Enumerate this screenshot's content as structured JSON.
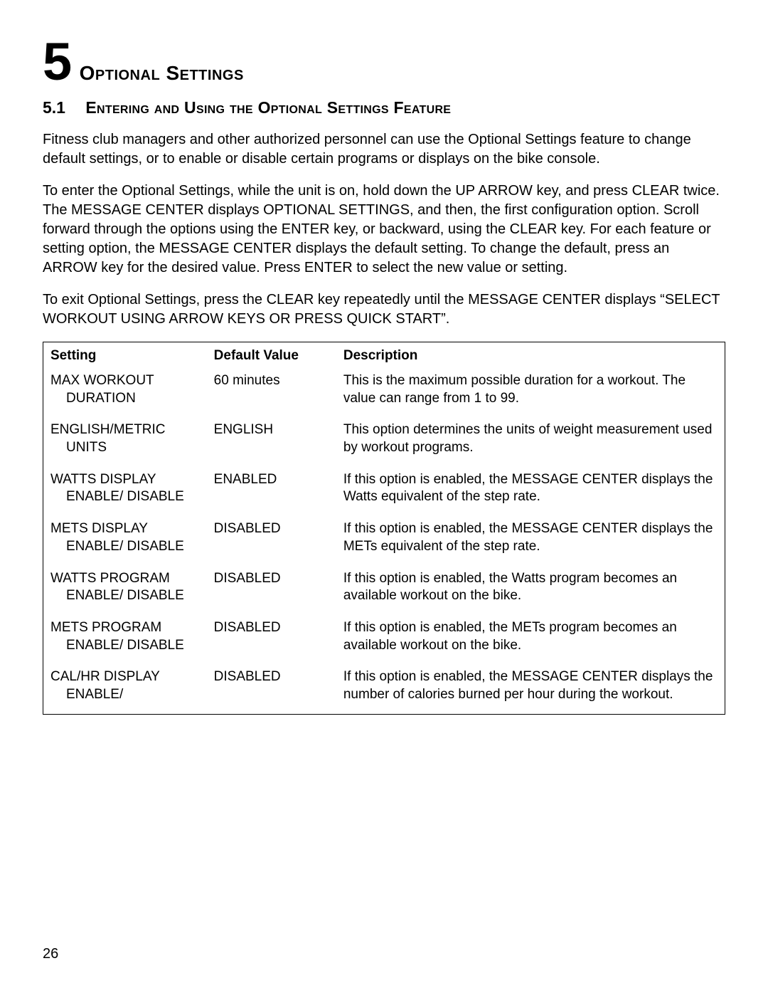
{
  "chapter": {
    "number": "5",
    "title": "Optional Settings"
  },
  "section": {
    "number": "5.1",
    "title": "Entering and Using the Optional Settings Feature"
  },
  "paragraphs": {
    "p1": "Fitness club managers and other authorized personnel can use the Optional Settings feature to change default settings, or to enable or disable certain programs or displays on the bike console.",
    "p2": "To enter the Optional Settings, while the unit is on, hold down the UP ARROW key, and press CLEAR twice. The MESSAGE CENTER displays OPTIONAL SETTINGS, and then, the first configuration option. Scroll forward through the options using the ENTER key, or backward, using the  CLEAR key. For each feature or setting option, the MESSAGE CENTER displays the default setting. To change the default, press an ARROW key for the desired value. Press ENTER to select the new value or setting.",
    "p3": "To exit Optional Settings, press the CLEAR key repeatedly until the MESSAGE CENTER displays “SELECT WORKOUT USING ARROW KEYS OR PRESS QUICK START”."
  },
  "table": {
    "headers": {
      "setting": "Setting",
      "default": "Default Value",
      "description": "Description"
    },
    "rows": [
      {
        "setting_main": "MAX WORKOUT",
        "setting_sub": "DURATION",
        "default": "60 minutes",
        "description": "This is the maximum possible duration for a workout. The value can range from 1 to 99."
      },
      {
        "setting_main": "ENGLISH/METRIC",
        "setting_sub": "UNITS",
        "default": "ENGLISH",
        "description": "This option determines the units of weight measurement used by workout programs."
      },
      {
        "setting_main": "WATTS DISPLAY",
        "setting_sub": "ENABLE/ DISABLE",
        "default": "ENABLED",
        "description": "If this option is enabled, the MESSAGE CENTER displays the Watts equivalent of the step rate."
      },
      {
        "setting_main": "METS DISPLAY",
        "setting_sub": "ENABLE/ DISABLE",
        "default": "DISABLED",
        "description": "If this option is enabled, the MESSAGE CENTER displays the METs equivalent of the step rate."
      },
      {
        "setting_main": "WATTS PROGRAM",
        "setting_sub": "ENABLE/ DISABLE",
        "default": "DISABLED",
        "description": "If this option is enabled, the Watts program becomes an available workout on the bike."
      },
      {
        "setting_main": "METS PROGRAM",
        "setting_sub": "ENABLE/ DISABLE",
        "default": "DISABLED",
        "description": "If this option is enabled, the METs program becomes an available workout on the bike."
      },
      {
        "setting_main": "CAL/HR DISPLAY",
        "setting_sub": "ENABLE/",
        "default": "DISABLED",
        "description": "If this option is enabled, the MESSAGE CENTER displays the number of calories burned per hour during the workout."
      }
    ]
  },
  "page_number": "26"
}
